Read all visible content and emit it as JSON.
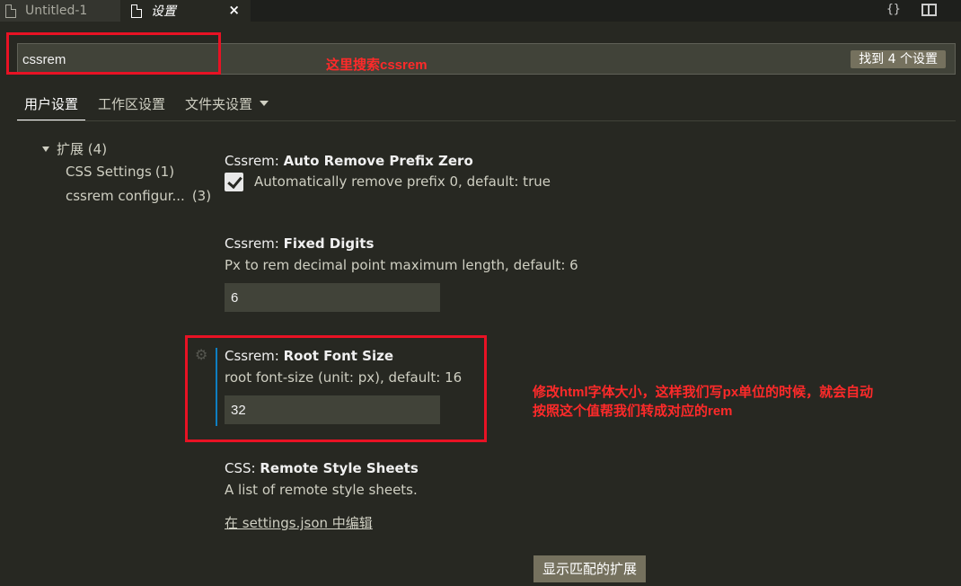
{
  "tabs": [
    {
      "label": "Untitled-1"
    },
    {
      "label": "设置",
      "close": "×"
    }
  ],
  "top_actions": {
    "braces": "{}"
  },
  "search": {
    "value": "cssrem",
    "count_badge": "找到 4 个设置"
  },
  "scope_tabs": {
    "user": "用户设置",
    "workspace": "工作区设置",
    "folder": "文件夹设置"
  },
  "tree": {
    "ext_label": "扩展",
    "ext_count": "(4)",
    "items": [
      {
        "label": "CSS Settings",
        "count": "(1)"
      },
      {
        "label": "cssrem configur...",
        "count": "(3)"
      }
    ]
  },
  "settings": [
    {
      "category": "Cssrem: ",
      "name": "Auto Remove Prefix Zero",
      "checkbox_label": "Automatically remove prefix 0, default: true",
      "checked": true
    },
    {
      "category": "Cssrem: ",
      "name": "Fixed Digits",
      "description": "Px to rem decimal point maximum length, default: 6",
      "value": "6"
    },
    {
      "category": "Cssrem: ",
      "name": "Root Font Size",
      "description": "root font-size (unit: px), default: 16",
      "value": "32"
    },
    {
      "category": "CSS: ",
      "name": "Remote Style Sheets",
      "description": "A list of remote style sheets.",
      "link": "在 settings.json 中编辑"
    }
  ],
  "show_extensions_button": "显示匹配的扩展",
  "annotations": {
    "search_note": "这里搜索cssrem",
    "root_note_line1": "修改html字体大小，这样我们写px单位的时候，就会自动",
    "root_note_line2": "按照这个值帮我们转成对应的rem"
  },
  "colors": {
    "annotation": "#e81224",
    "accent": "#0e7fc2",
    "background": "#272822"
  },
  "icons": [
    "file-icon",
    "close-icon",
    "braces-icon",
    "split-editor-icon",
    "chevron-down-icon",
    "tree-caret-icon",
    "check-icon",
    "gear-icon"
  ]
}
